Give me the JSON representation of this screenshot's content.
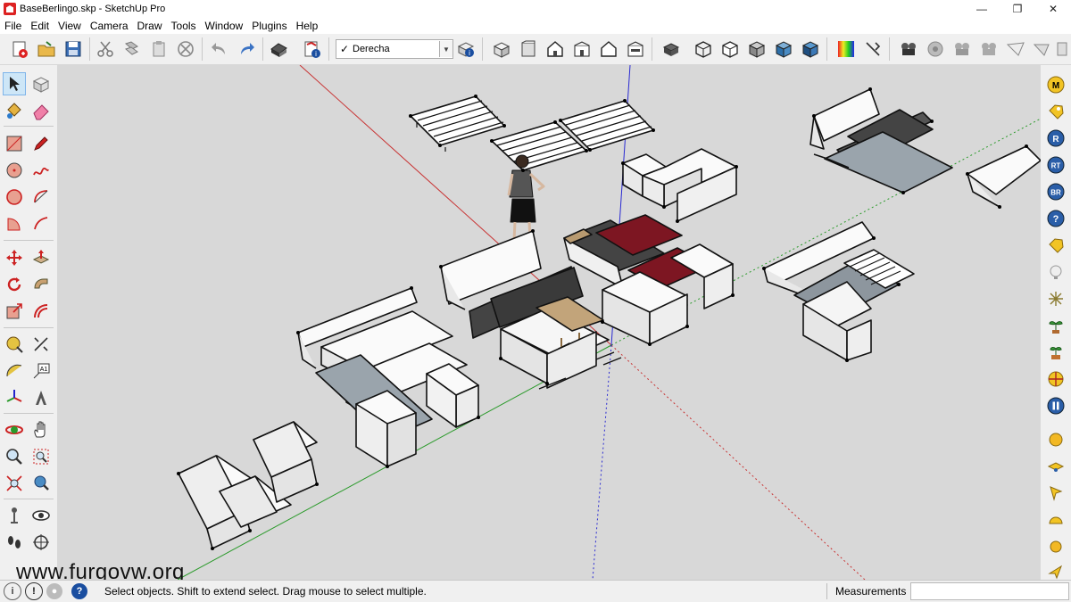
{
  "window": {
    "title": "BaseBerlingo.skp - SketchUp Pro",
    "minimize": "—",
    "maximize": "❐",
    "close": "✕"
  },
  "menu": [
    "File",
    "Edit",
    "View",
    "Camera",
    "Draw",
    "Tools",
    "Window",
    "Plugins",
    "Help"
  ],
  "toolbar": {
    "scene_value": "Derecha"
  },
  "right_palette": {
    "labels": [
      "M",
      "R",
      "RT",
      "BR",
      "?"
    ]
  },
  "viewport": {
    "watermark": "www.furgovw.org",
    "background_color": "#d8d8d8",
    "axis_colors": {
      "red": "#c83232",
      "green": "#2a9a2a",
      "blue": "#2a2ad2"
    }
  },
  "status": {
    "message": "Select objects. Shift to extend select. Drag mouse to select multiple.",
    "measurements_label": "Measurements",
    "measurements_value": ""
  }
}
